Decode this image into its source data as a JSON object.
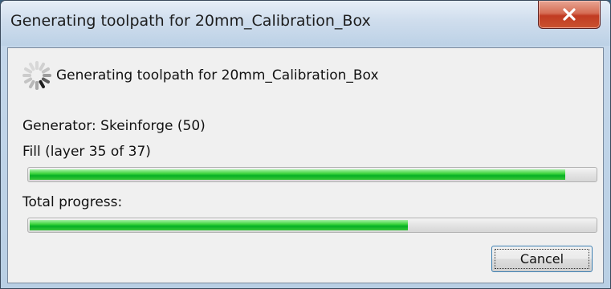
{
  "window": {
    "title": "Generating toolpath for 20mm_Calibration_Box",
    "close_icon": "close-icon"
  },
  "dialog": {
    "heading": "Generating toolpath for 20mm_Calibration_Box",
    "spinner_icon": "spinner-icon",
    "generator_label": "Generator: Skeinforge (50)",
    "step_label": "Fill (layer 35 of 37)",
    "step_progress_percent": 94.7,
    "total_label": "Total progress:",
    "total_progress_percent": 66.9,
    "cancel_label": "Cancel"
  },
  "colors": {
    "progress_green": "#06b025",
    "close_red": "#c13b22",
    "focus_blue": "#3c7fb1"
  }
}
